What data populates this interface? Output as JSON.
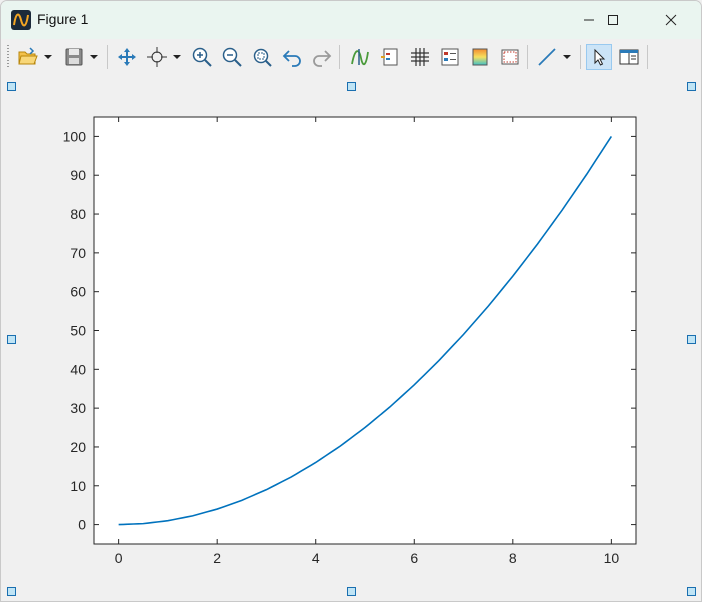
{
  "window": {
    "title": "Figure 1",
    "icon": "figure-app-icon",
    "controls": [
      "minimize-icon",
      "maximize-icon",
      "close-icon"
    ]
  },
  "toolbar": {
    "items": [
      {
        "name": "open-file-icon",
        "dropdown": true
      },
      {
        "name": "save-icon",
        "dropdown": true
      },
      {
        "name": "pan-icon"
      },
      {
        "name": "data-cursor-icon",
        "dropdown": true
      },
      {
        "name": "zoom-in-icon"
      },
      {
        "name": "zoom-out-icon"
      },
      {
        "name": "zoom-fit-icon"
      },
      {
        "name": "undo-icon"
      },
      {
        "name": "redo-icon"
      },
      {
        "name": "edit-plot-icon"
      },
      {
        "name": "legend-icon"
      },
      {
        "name": "grid-icon"
      },
      {
        "name": "properties-icon"
      },
      {
        "name": "colormap-icon"
      },
      {
        "name": "frame-icon"
      },
      {
        "name": "line-style-icon",
        "dropdown": true
      },
      {
        "name": "select-icon",
        "active": true
      },
      {
        "name": "layout-panel-icon"
      }
    ]
  },
  "chart_data": {
    "type": "line",
    "title": "",
    "xlabel": "",
    "ylabel": "",
    "xlim": [
      -0.5,
      10.5
    ],
    "ylim": [
      -5,
      105
    ],
    "xticks": [
      0,
      2,
      4,
      6,
      8,
      10
    ],
    "yticks": [
      0,
      10,
      20,
      30,
      40,
      50,
      60,
      70,
      80,
      90,
      100
    ],
    "grid": false,
    "legend": "none",
    "series": [
      {
        "color": "#0072bd",
        "x": [
          0,
          0.5,
          1,
          1.5,
          2,
          2.5,
          3,
          3.5,
          4,
          4.5,
          5,
          5.5,
          6,
          6.5,
          7,
          7.5,
          8,
          8.5,
          9,
          9.5,
          10
        ],
        "y": [
          0,
          0.25,
          1,
          2.25,
          4,
          6.25,
          9,
          12.25,
          16,
          20.25,
          25,
          30.25,
          36,
          42.25,
          49,
          56.25,
          64,
          72.25,
          81,
          90.25,
          100
        ]
      }
    ]
  }
}
